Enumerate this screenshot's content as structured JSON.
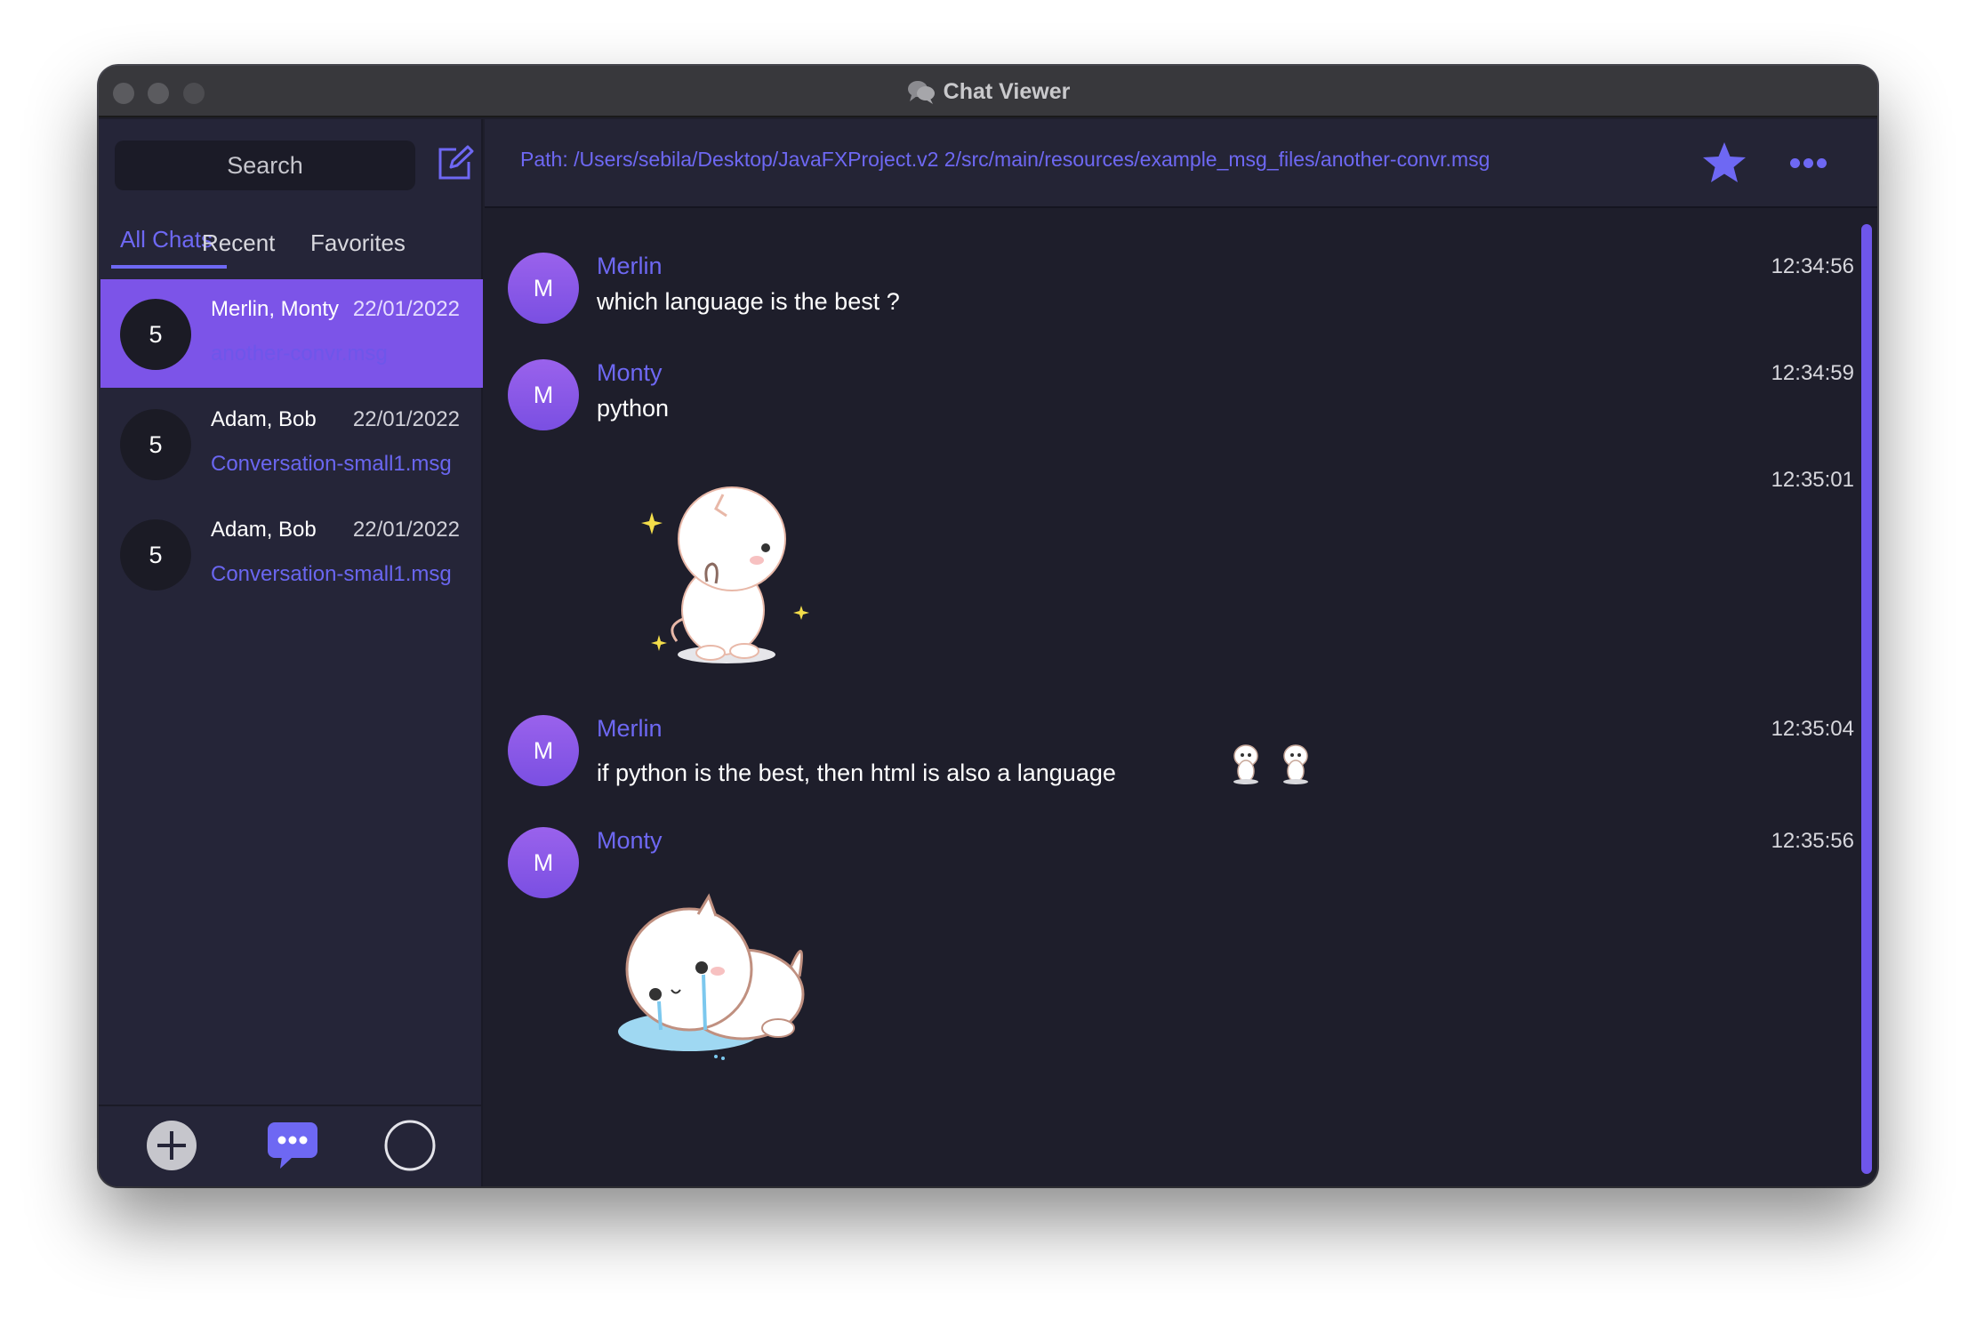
{
  "window": {
    "title": "Chat Viewer"
  },
  "sidebar": {
    "search_label": "Search",
    "tabs": [
      "All Chats",
      "Recent",
      "Favorites"
    ],
    "chats": [
      {
        "badge": "5",
        "names": "Merlin, Monty",
        "date": "22/01/2022",
        "file": "another-convr.msg",
        "selected": true
      },
      {
        "badge": "5",
        "names": "Adam, Bob",
        "date": "22/01/2022",
        "file": "Conversation-small1.msg",
        "selected": false
      },
      {
        "badge": "5",
        "names": "Adam, Bob",
        "date": "22/01/2022",
        "file": "Conversation-small1.msg",
        "selected": false
      }
    ],
    "bottom_icons": [
      "add-icon",
      "chat-bubble-icon",
      "circle-icon"
    ]
  },
  "main": {
    "path": "Path: /Users/sebila/Desktop/JavaFXProject.v2 2/src/main/resources/example_msg_files/another-convr.msg",
    "header_icons": [
      "star-icon",
      "more-icon"
    ],
    "messages": [
      {
        "avatar": "M",
        "sender": "Merlin",
        "text": "which language is the best ?",
        "time": "12:34:56"
      },
      {
        "avatar": "M",
        "sender": "Monty",
        "text": "python",
        "time": "12:34:59"
      },
      {
        "time": "12:35:01",
        "sticker": "cat-sticker-happy"
      },
      {
        "avatar": "M",
        "sender": "Merlin",
        "text": "if python is the best, then html is also a language",
        "time": "12:35:04",
        "emoji": "cat-emoji"
      },
      {
        "avatar": "M",
        "sender": "Monty",
        "time": "12:35:56",
        "sticker": "cat-sticker-crying"
      }
    ]
  },
  "colors": {
    "accent": "#6e68f3",
    "selected_row": "#7c54e8",
    "sidebar_bg": "#252538",
    "main_bg": "#1e1e2b"
  }
}
